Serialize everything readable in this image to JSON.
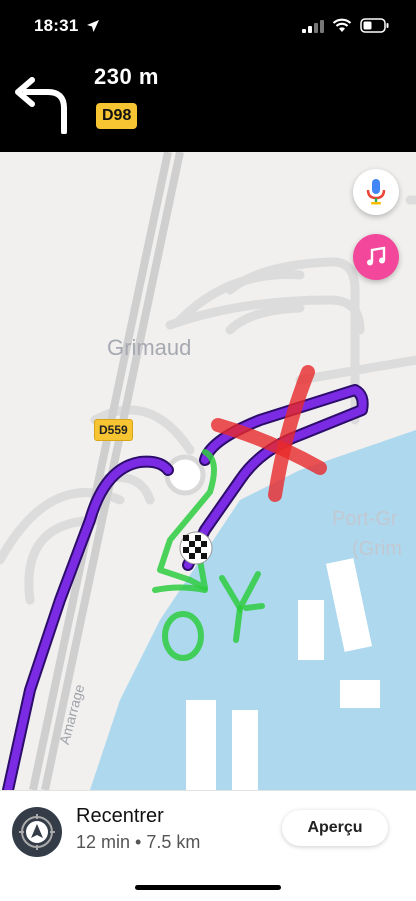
{
  "status_bar": {
    "time": "18:31"
  },
  "navigation": {
    "distance": "230 m",
    "road": "D98",
    "turn_direction": "turn-left-icon"
  },
  "map": {
    "town_label": "Grimaud",
    "port_label_line1": "Port-Gr",
    "port_label_line2": "(Grim",
    "street_label": "Amarrage",
    "road_shield": "D559",
    "annotation_text": "OY",
    "colors": {
      "route": "#6a1fd1",
      "water": "#add8ee",
      "annotation_green": "#2ecc40",
      "annotation_red": "#e8292a"
    }
  },
  "buttons": {
    "voice": "microphone-icon",
    "music": "music-note-icon"
  },
  "bottom_panel": {
    "title": "Recentrer",
    "subtitle": "12 min • 7.5 km",
    "preview_button": "Aperçu"
  }
}
